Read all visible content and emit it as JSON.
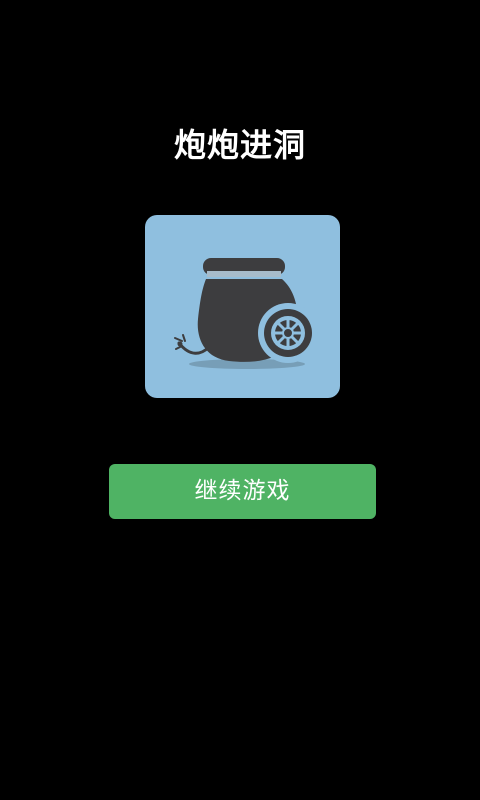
{
  "app": {
    "title": "炮炮进洞"
  },
  "icon": {
    "name": "cannon-icon"
  },
  "actions": {
    "continue_label": "继续游戏"
  },
  "colors": {
    "background": "#000000",
    "title": "#ffffff",
    "icon_tile": "#8fbfdf",
    "icon_body": "#3d3d3f",
    "continue_button": "#4fb364",
    "continue_text": "#ffffff"
  }
}
